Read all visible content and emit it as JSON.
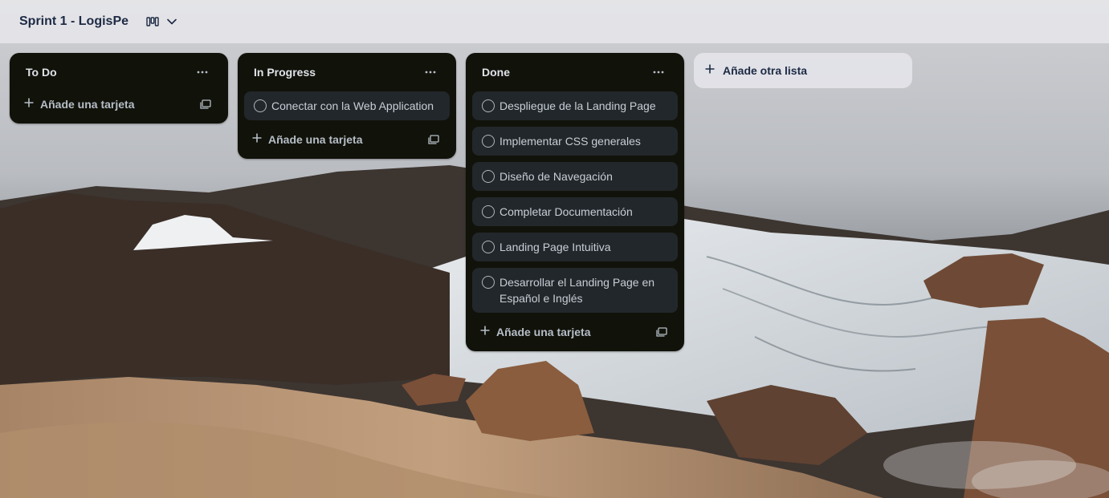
{
  "board": {
    "title": "Sprint 1 - LogisPe",
    "view_icon": "board-view-icon",
    "chevron_icon": "chevron-down-icon"
  },
  "lists": [
    {
      "title": "To Do",
      "cards": [],
      "add_card_label": "Añade una tarjeta"
    },
    {
      "title": "In Progress",
      "cards": [
        {
          "title": "Conectar con la Web Application"
        }
      ],
      "add_card_label": "Añade una tarjeta"
    },
    {
      "title": "Done",
      "cards": [
        {
          "title": "Despliegue de la Landing Page"
        },
        {
          "title": "Implementar CSS generales"
        },
        {
          "title": "Diseño de Navegación"
        },
        {
          "title": "Completar Documentación"
        },
        {
          "title": "Landing Page Intuitiva"
        },
        {
          "title": "Desarrollar el Landing Page en Español e Inglés"
        }
      ],
      "add_card_label": "Añade una tarjeta"
    }
  ],
  "add_list": {
    "label": "Añade otra lista"
  },
  "icons": {
    "list_menu": "more-horizontal-icon",
    "add": "plus-icon",
    "template": "card-template-icon",
    "card_check": "circle-check-icon"
  },
  "colors": {
    "list_bg": "#11120a",
    "card_bg": "#22272b",
    "header_bg": "#e8e8ec",
    "title_text": "#1d2a44"
  }
}
